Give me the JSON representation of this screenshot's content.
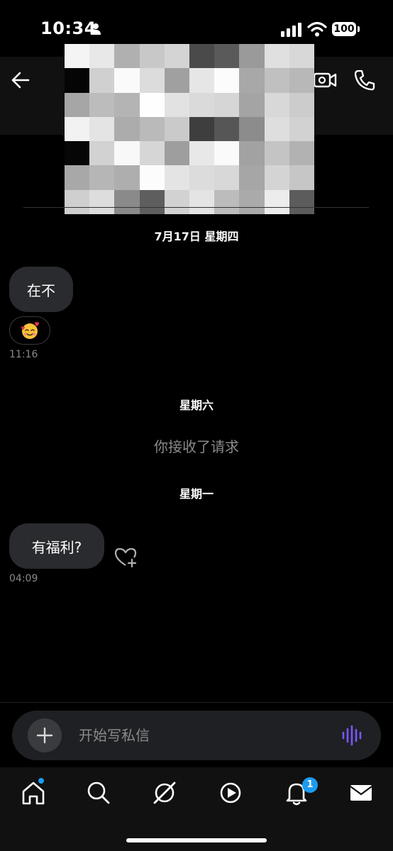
{
  "status_bar": {
    "time": "10:34",
    "battery": "100"
  },
  "header": {
    "avatar": "pixelated-profile-image"
  },
  "messages": [
    {
      "type": "date",
      "text": "7月17日 星期四"
    },
    {
      "type": "incoming",
      "text": "在不"
    },
    {
      "type": "reaction",
      "emoji": "🥰"
    },
    {
      "type": "time",
      "text": "11:16"
    },
    {
      "type": "date",
      "text": "星期六"
    },
    {
      "type": "system",
      "text": "你接收了请求"
    },
    {
      "type": "date",
      "text": "星期一"
    },
    {
      "type": "incoming",
      "text": "有福利?"
    },
    {
      "type": "time",
      "text": "04:09"
    }
  ],
  "composer": {
    "placeholder": "开始写私信"
  },
  "tab_bar": {
    "notifications_badge": "1"
  },
  "colors": {
    "accent": "#1d9bf0",
    "voice": "#7856ff",
    "bubble": "#2a2b2e",
    "muted": "#8a8a8a"
  }
}
